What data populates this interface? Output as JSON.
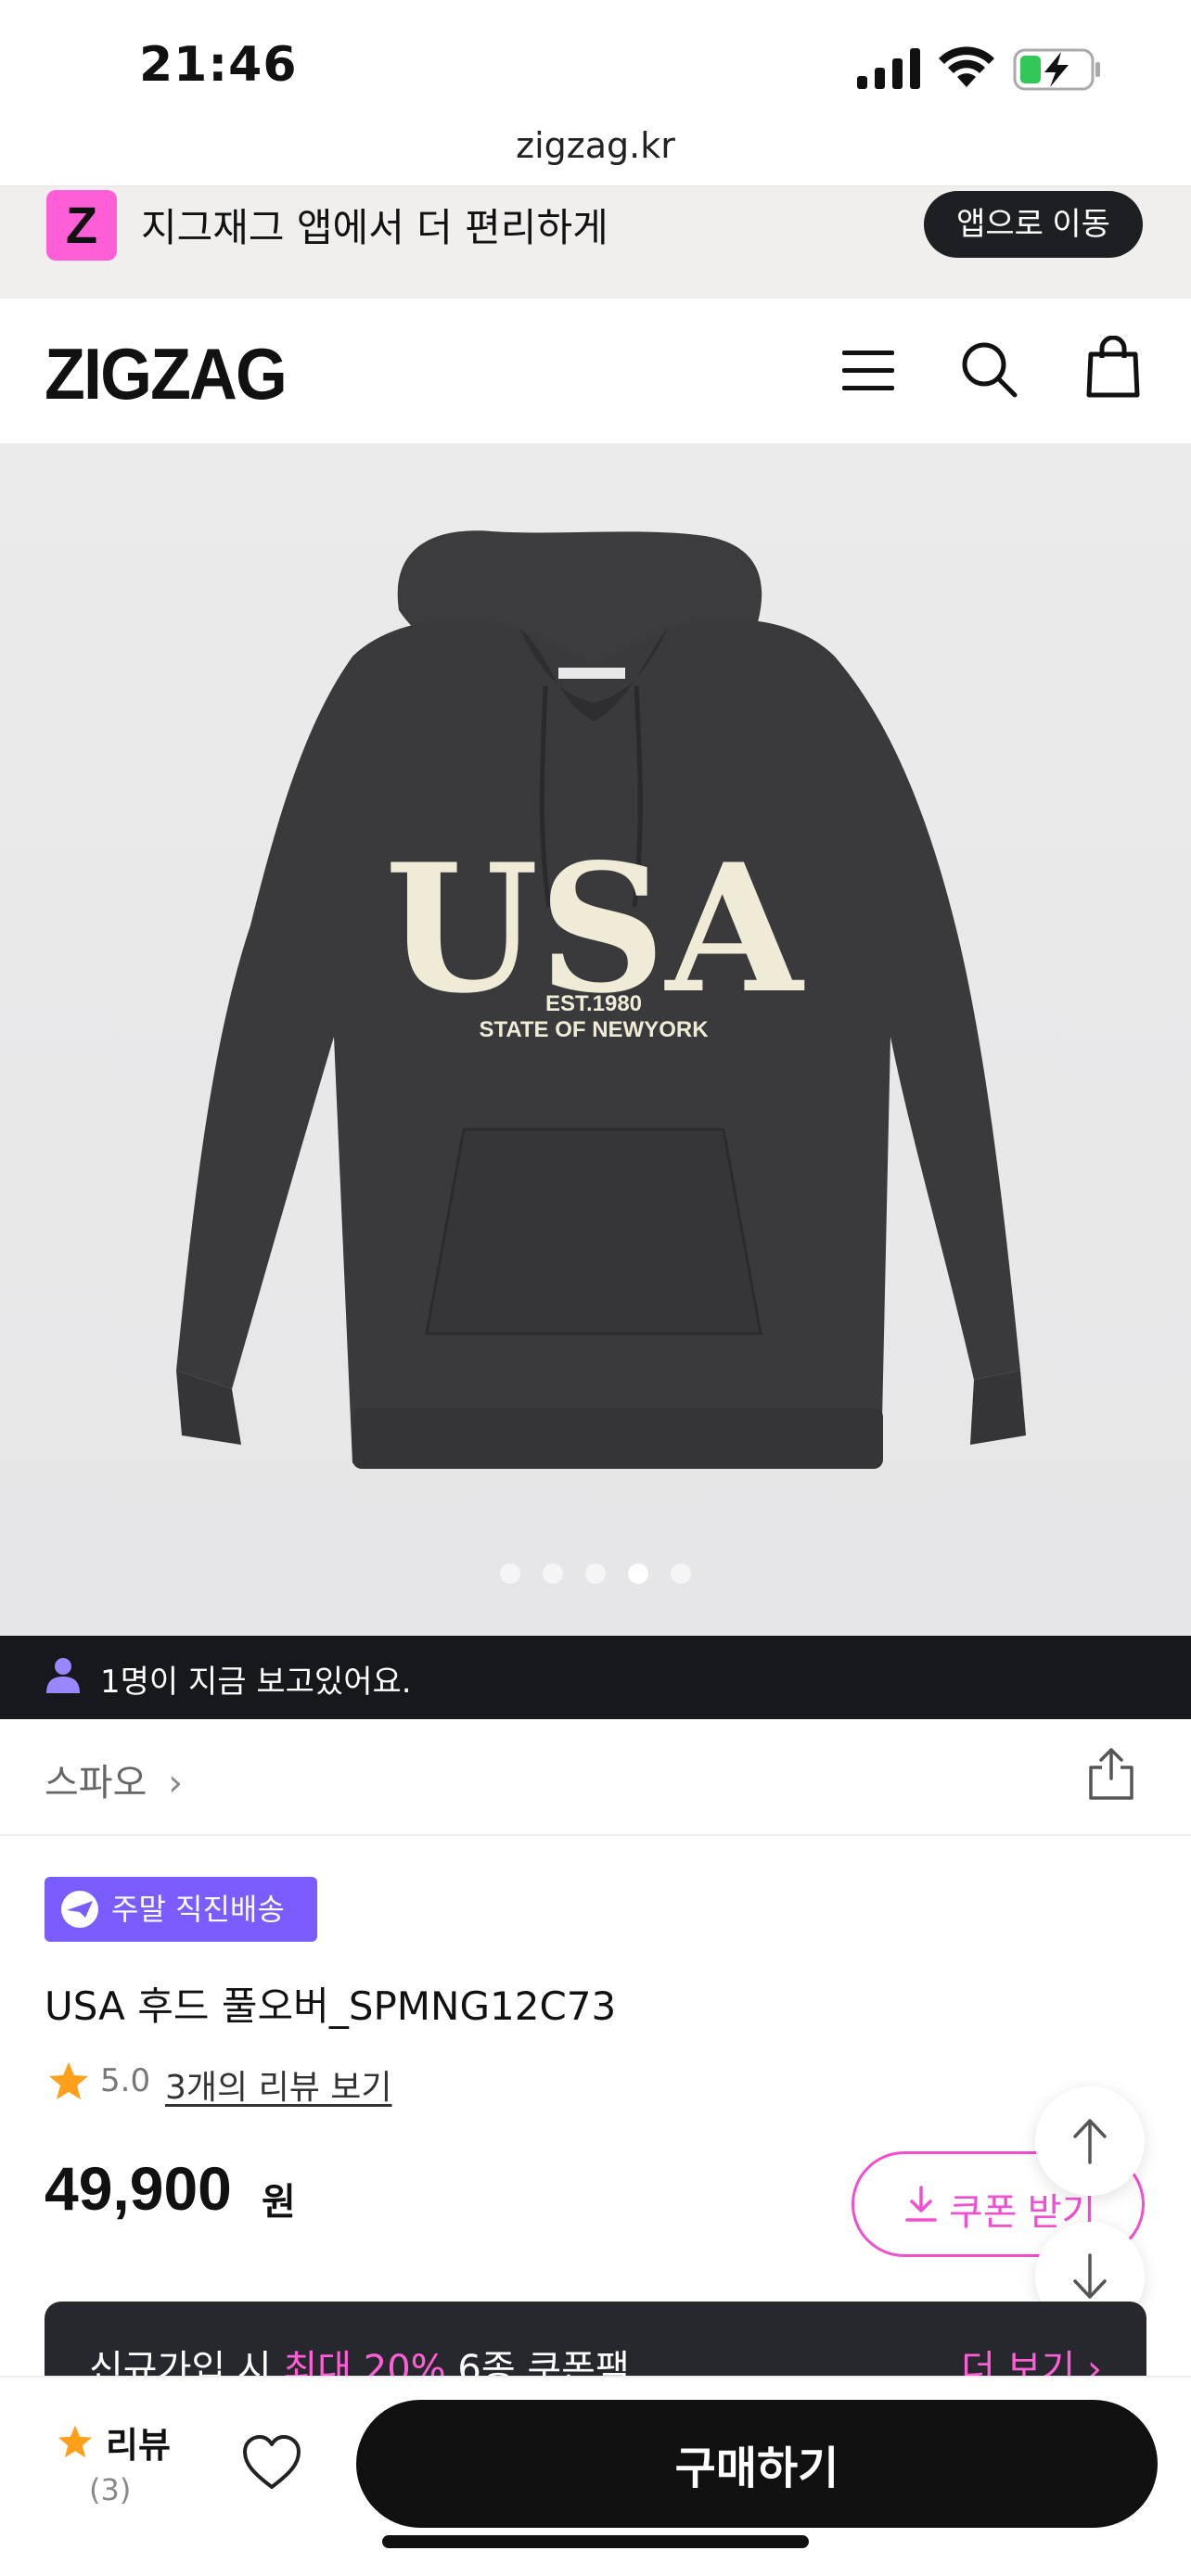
{
  "status_bar": {
    "time": "21:46",
    "url": "zigzag.kr",
    "icons": [
      "signal-icon",
      "wifi-icon",
      "battery-charging-icon"
    ]
  },
  "app_banner": {
    "logo_letter": "Z",
    "text": "지그재그 앱에서 더 편리하게",
    "button_label": "앱으로 이동"
  },
  "header": {
    "logo": "ZIGZAG",
    "icons": [
      "menu-icon",
      "search-icon",
      "shopping-bag-icon"
    ]
  },
  "product_image": {
    "print_main": "USA",
    "print_sub1": "EST.1980",
    "print_sub2": "STATE OF NEWYORK",
    "carousel_total": 5,
    "carousel_active_index": 4
  },
  "viewer_bar": {
    "text": "1명이 지금 보고있어요."
  },
  "brand_row": {
    "brand": "스파오",
    "chevron": "›"
  },
  "product": {
    "tag": "주말 직진배송",
    "name": "USA 후드 풀오버_SPMNG12C73",
    "rating": "5.0",
    "review_link": "3개의 리뷰 보기",
    "price": "49,900",
    "price_unit": "원",
    "coupon_label": "쿠폰 받기"
  },
  "promo": {
    "text_before": "신규가입 시 ",
    "highlight": "최대 20%",
    "text_after": " 6종 쿠폰팩",
    "more": "더 보기 ›"
  },
  "bottom_bar": {
    "review_label": "리뷰",
    "review_count": "(3)",
    "buy_label": "구매하기"
  },
  "colors": {
    "accent_pink": "#ff5fd6",
    "tag_purple": "#7a5cff",
    "dark": "#17181c",
    "star": "#ff9f1a"
  }
}
